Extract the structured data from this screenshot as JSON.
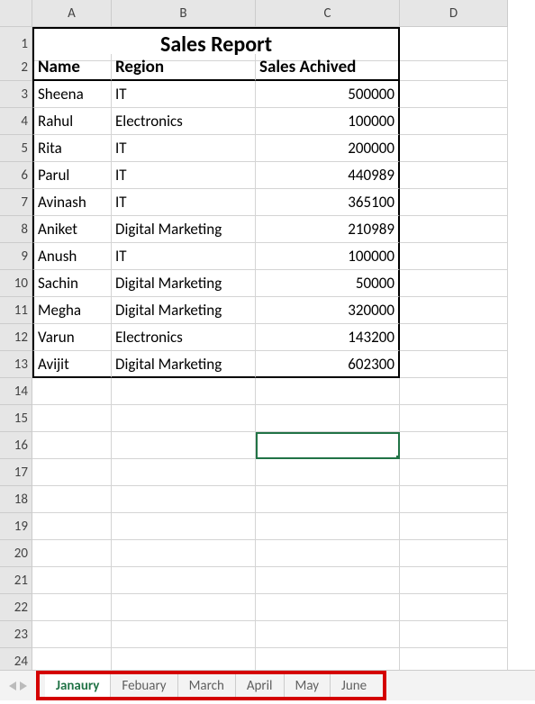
{
  "columns": [
    "A",
    "B",
    "C",
    "D"
  ],
  "row_count": 24,
  "title": "Sales Report",
  "headers": {
    "name": "Name",
    "region": "Region",
    "sales": "Sales Achived"
  },
  "rows": [
    {
      "name": "Sheena",
      "region": "IT",
      "sales": "500000"
    },
    {
      "name": "Rahul",
      "region": "Electronics",
      "sales": "100000"
    },
    {
      "name": "Rita",
      "region": "IT",
      "sales": "200000"
    },
    {
      "name": "Parul",
      "region": "IT",
      "sales": "440989"
    },
    {
      "name": "Avinash",
      "region": "IT",
      "sales": "365100"
    },
    {
      "name": "Aniket",
      "region": "Digital Marketing",
      "sales": "210989"
    },
    {
      "name": "Anush",
      "region": "IT",
      "sales": "100000"
    },
    {
      "name": "Sachin",
      "region": "Digital Marketing",
      "sales": "50000"
    },
    {
      "name": "Megha",
      "region": "Digital Marketing",
      "sales": "320000"
    },
    {
      "name": "Varun",
      "region": "Electronics",
      "sales": "143200"
    },
    {
      "name": "Avijit",
      "region": "Digital Marketing",
      "sales": "602300"
    }
  ],
  "selected_cell": "C16",
  "sheets": {
    "active_index": 0,
    "tabs": [
      "Janaury",
      "Febuary",
      "March",
      "April",
      "May",
      "June"
    ]
  },
  "chart_data": {
    "type": "table",
    "title": "Sales Report",
    "columns": [
      "Name",
      "Region",
      "Sales Achived"
    ],
    "rows": [
      [
        "Sheena",
        "IT",
        500000
      ],
      [
        "Rahul",
        "Electronics",
        100000
      ],
      [
        "Rita",
        "IT",
        200000
      ],
      [
        "Parul",
        "IT",
        440989
      ],
      [
        "Avinash",
        "IT",
        365100
      ],
      [
        "Aniket",
        "Digital Marketing",
        210989
      ],
      [
        "Anush",
        "IT",
        100000
      ],
      [
        "Sachin",
        "Digital Marketing",
        50000
      ],
      [
        "Megha",
        "Digital Marketing",
        320000
      ],
      [
        "Varun",
        "Electronics",
        143200
      ],
      [
        "Avijit",
        "Digital Marketing",
        602300
      ]
    ]
  }
}
